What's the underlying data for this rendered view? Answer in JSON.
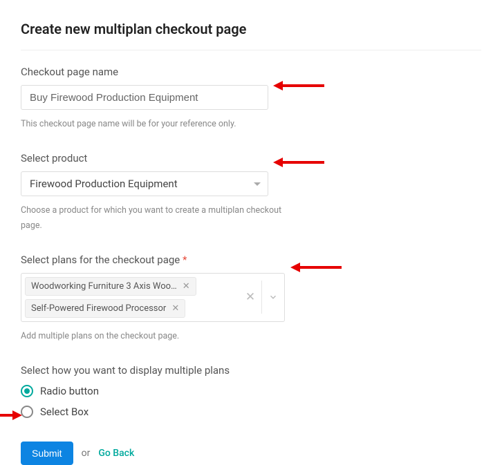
{
  "page_title": "Create new multiplan checkout page",
  "checkout_name": {
    "label": "Checkout page name",
    "value": "Buy Firewood Production Equipment",
    "help": "This checkout page name will be for your reference only."
  },
  "product": {
    "label": "Select product",
    "selected": "Firewood Production Equipment",
    "help": "Choose a product for which you want to create a multiplan checkout page."
  },
  "plans": {
    "label": "Select plans for the checkout page",
    "required_mark": "*",
    "tags": [
      "Woodworking Furniture 3 Axis Woo…",
      "Self-Powered Firewood Processor"
    ],
    "help": "Add multiple plans on the checkout page."
  },
  "display": {
    "label": "Select how you want to display multiple plans",
    "options": [
      "Radio button",
      "Select Box"
    ],
    "selected_index": 0
  },
  "actions": {
    "submit": "Submit",
    "or": "or",
    "goback": "Go Back"
  }
}
